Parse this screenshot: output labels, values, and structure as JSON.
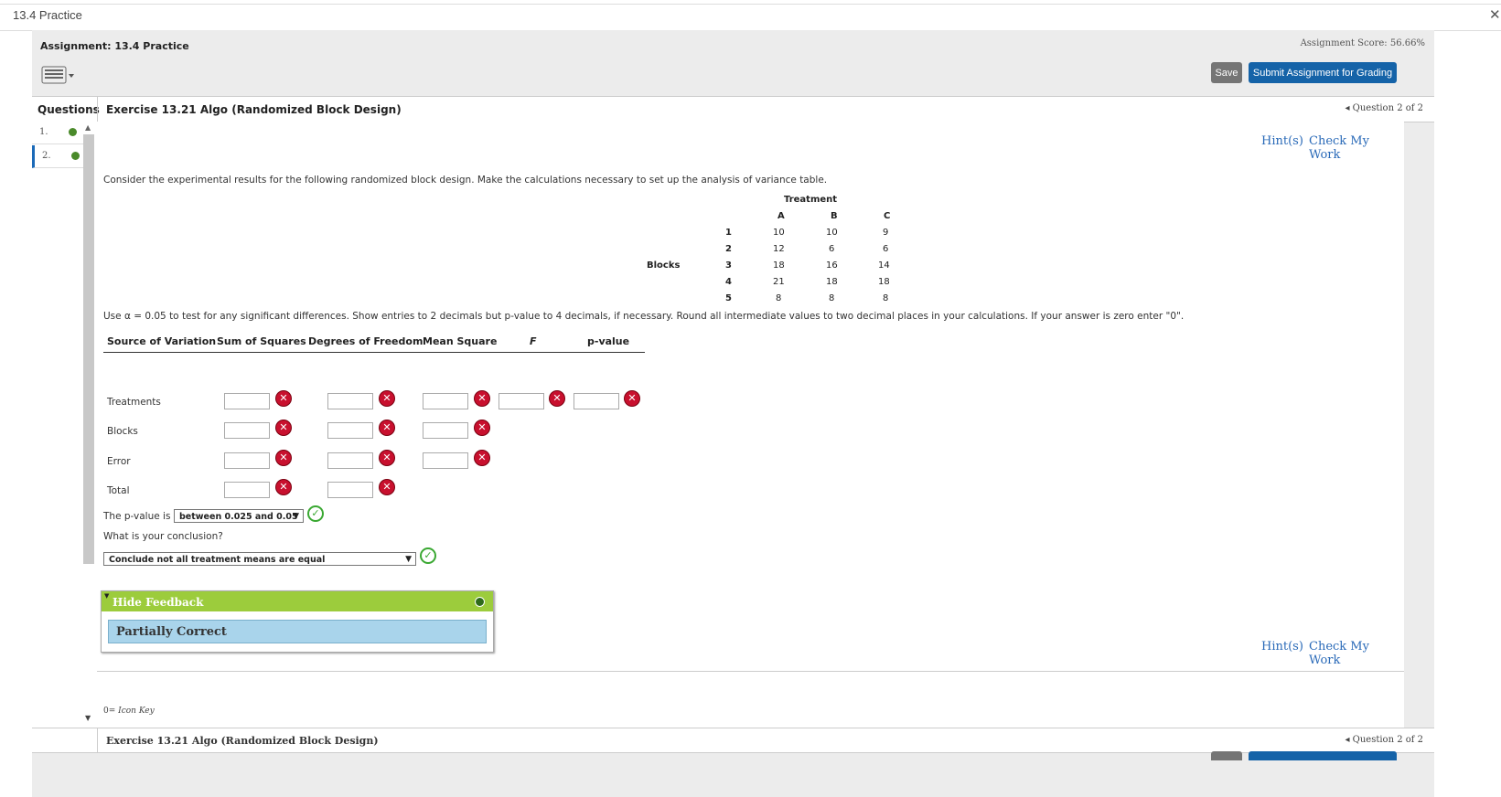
{
  "window": {
    "title": "13.4 Practice"
  },
  "header": {
    "assignment_label": "Assignment: 13.4 Practice",
    "score": "Assignment Score: 56.66%",
    "save_label": "Save",
    "submit_label": "Submit Assignment for Grading"
  },
  "qbar": {
    "questions_label": "Questions",
    "exercise_title": "Exercise 13.21 Algo (Randomized Block Design)",
    "question_nav": "◂ Question 2 of 2"
  },
  "sidebar": {
    "items": [
      {
        "label": "1."
      },
      {
        "label": "2."
      }
    ]
  },
  "links": {
    "hints": "Hint(s)",
    "check": "Check My Work"
  },
  "problem": {
    "prompt": "Consider the experimental results for the following randomized block design. Make the calculations necessary to set up the analysis of variance table.",
    "treatment_label": "Treatment",
    "blocks_label": "Blocks",
    "columns": [
      "A",
      "B",
      "C"
    ],
    "rows": [
      {
        "block": "1",
        "values": [
          "10",
          "10",
          "9"
        ]
      },
      {
        "block": "2",
        "values": [
          "12",
          "6",
          "6"
        ]
      },
      {
        "block": "3",
        "values": [
          "18",
          "16",
          "14"
        ]
      },
      {
        "block": "4",
        "values": [
          "21",
          "18",
          "18"
        ]
      },
      {
        "block": "5",
        "values": [
          "8",
          "8",
          "8"
        ]
      }
    ],
    "instruction": "Use α = 0.05 to test for any significant differences. Show entries to 2 decimals but p-value to 4 decimals, if necessary. Round all intermediate values to two decimal places in your calculations. If your answer is zero enter \"0\"."
  },
  "anova": {
    "headers": [
      "Source of Variation",
      "Sum of Squares",
      "Degrees of Freedom",
      "Mean Square",
      "F",
      "p-value"
    ],
    "rows": [
      "Treatments",
      "Blocks",
      "Error",
      "Total"
    ]
  },
  "pvalue_question": {
    "label": "The p-value is",
    "selected": "between 0.025 and 0.05"
  },
  "conclusion_question": {
    "label": "What is your conclusion?",
    "selected": "Conclude not all treatment means are equal"
  },
  "feedback": {
    "toggle_label": "Hide Feedback",
    "result": "Partially Correct"
  },
  "icon_key": "Icon Key",
  "footer": {
    "exercise_title": "Exercise 13.21 Algo (Randomized Block Design)",
    "question_nav": "◂ Question 2 of 2"
  },
  "colors": {
    "submit": "#1563a8",
    "save": "#757575",
    "feedback_header": "#9ccc3c",
    "feedback_body": "#a9d4eb",
    "wrong": "#c8102e",
    "correct": "#3aa832",
    "link": "#2a6ab8"
  }
}
